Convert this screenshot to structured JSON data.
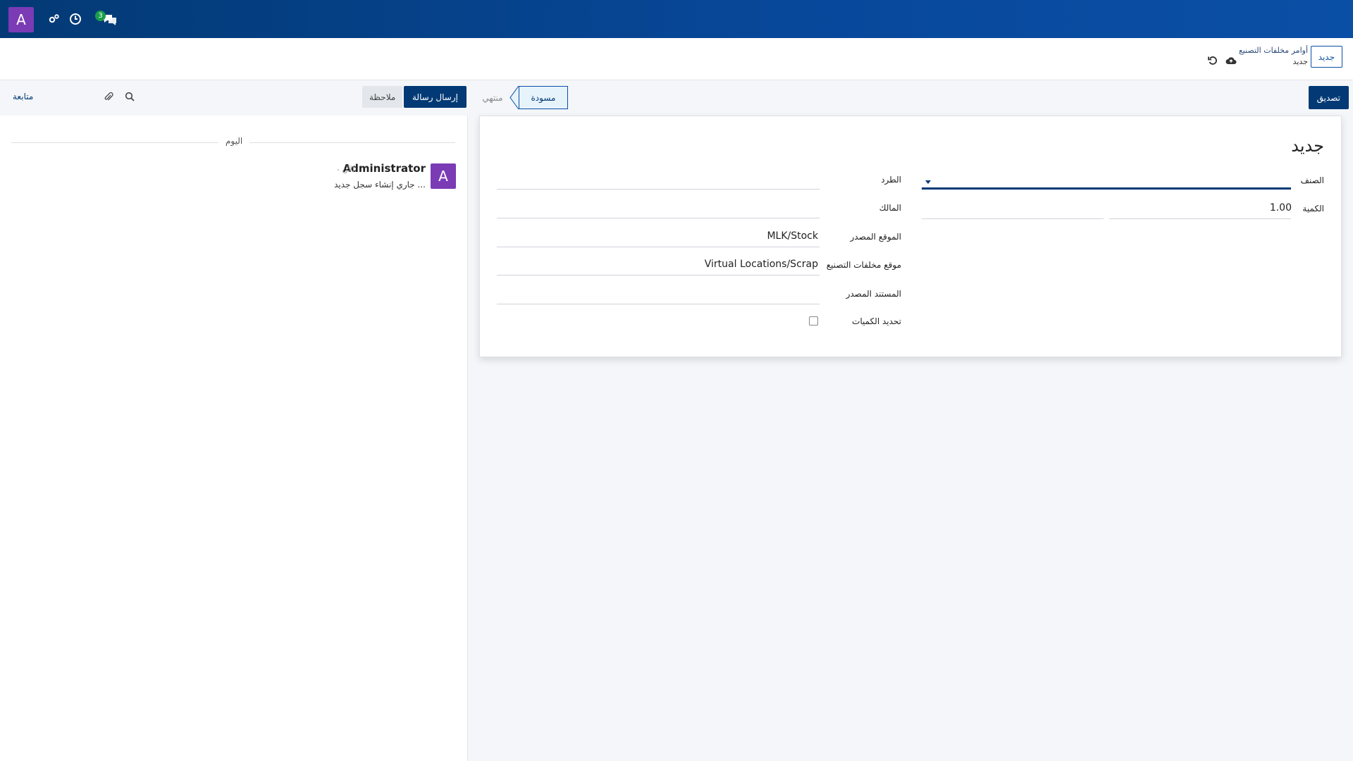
{
  "navbar": {
    "avatar_letter": "A",
    "icons": [
      "settings-icon",
      "clock-icon",
      "chat-icon"
    ],
    "chat_badge": "3"
  },
  "control_panel": {
    "new_button": "جديد",
    "breadcrumb_parent": "أوامر مخلفات التصنيع",
    "breadcrumb_current": "جديد",
    "icons": [
      "save-cloud-icon",
      "discard-icon"
    ]
  },
  "statusbar": {
    "confirm_button": "تصديق",
    "stages": [
      "مسودة",
      "منتهي"
    ],
    "active_stage": "مسودة"
  },
  "form": {
    "title": "جديد",
    "fields": {
      "product": {
        "label": "الصنف",
        "value": ""
      },
      "quantity": {
        "label": "الكمية",
        "value": "1.00"
      },
      "package": {
        "label": "الطرد",
        "value": ""
      },
      "owner": {
        "label": "المالك",
        "value": ""
      },
      "source_location": {
        "label": "الموقع المصدر",
        "value": "MLK/Stock"
      },
      "scrap_location": {
        "label": "موقع مخلفات التصنيع",
        "value": "Virtual Locations/Scrap"
      },
      "source_document": {
        "label": "المستند المصدر",
        "value": ""
      },
      "set_quantities": {
        "label": "تحديد الكميات",
        "checked": false
      }
    }
  },
  "chatter": {
    "send_message_button": "إرسال رسالة",
    "log_note_button": "ملاحظة",
    "follow_label": "متابعة",
    "day_label": "اليوم",
    "message": {
      "avatar_letter": "A",
      "author": "Administrator",
      "time": "- الآن",
      "body": "جاري إنشاء سجل جديد ..."
    }
  },
  "colors": {
    "navbar": "#033a75",
    "accent": "#0a4fa6",
    "avatar": "#7b3bb5",
    "badge": "#1a9e4a"
  }
}
